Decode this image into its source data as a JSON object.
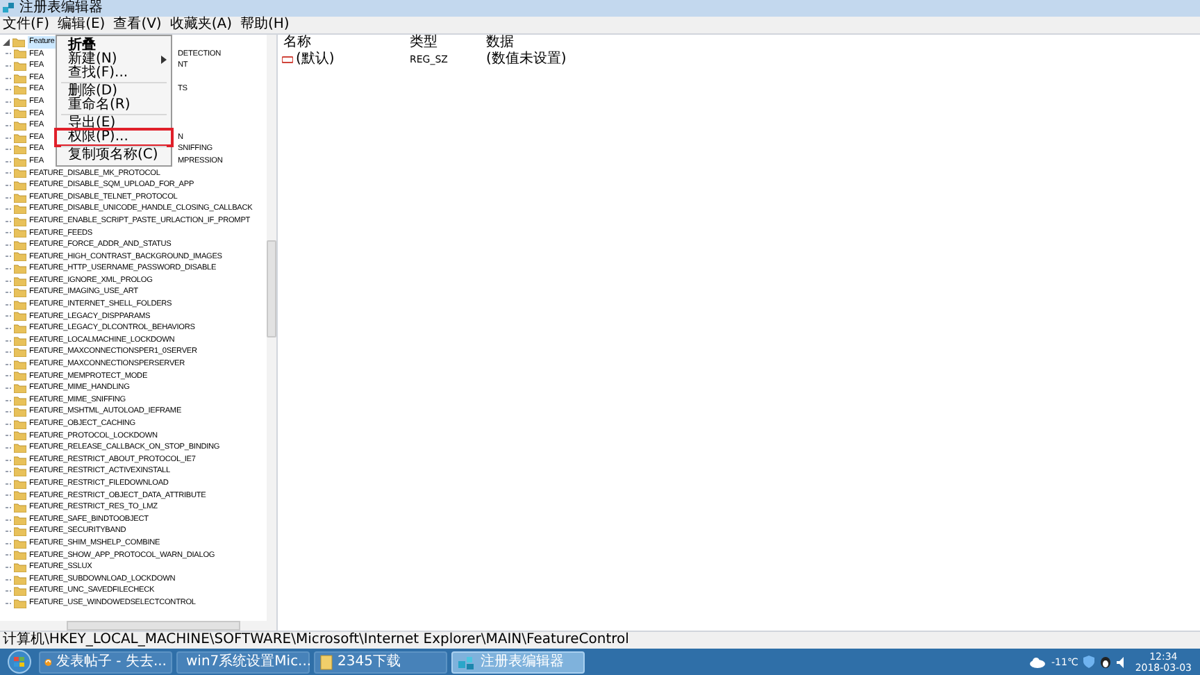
{
  "window": {
    "title": "注册表编辑器"
  },
  "menu_bar": [
    "文件(F)",
    "编辑(E)",
    "查看(V)",
    "收藏夹(A)",
    "帮助(H)"
  ],
  "tree": {
    "root": {
      "label": "Feature",
      "expanded": true,
      "selected": true
    },
    "covered_rows": [
      {
        "start": "FEA",
        "end": "DETECTION"
      },
      {
        "start": "FEA",
        "end": "NT"
      },
      {
        "start": "FEA",
        "end": ""
      },
      {
        "start": "FEA",
        "end": "TS"
      },
      {
        "start": "FEA",
        "end": ""
      },
      {
        "start": "FEA",
        "end": ""
      },
      {
        "start": "FEA",
        "end": ""
      },
      {
        "start": "FEA",
        "end": "N"
      },
      {
        "start": "FEA",
        "end": "SNIFFING"
      },
      {
        "start": "FEA",
        "end": "MPRESSION"
      }
    ],
    "rows": [
      "FEATURE_DISABLE_MK_PROTOCOL",
      "FEATURE_DISABLE_SQM_UPLOAD_FOR_APP",
      "FEATURE_DISABLE_TELNET_PROTOCOL",
      "FEATURE_DISABLE_UNICODE_HANDLE_CLOSING_CALLBACK",
      "FEATURE_ENABLE_SCRIPT_PASTE_URLACTION_IF_PROMPT",
      "FEATURE_FEEDS",
      "FEATURE_FORCE_ADDR_AND_STATUS",
      "FEATURE_HIGH_CONTRAST_BACKGROUND_IMAGES",
      "FEATURE_HTTP_USERNAME_PASSWORD_DISABLE",
      "FEATURE_IGNORE_XML_PROLOG",
      "FEATURE_IMAGING_USE_ART",
      "FEATURE_INTERNET_SHELL_FOLDERS",
      "FEATURE_LEGACY_DISPPARAMS",
      "FEATURE_LEGACY_DLCONTROL_BEHAVIORS",
      "FEATURE_LOCALMACHINE_LOCKDOWN",
      "FEATURE_MAXCONNECTIONSPER1_0SERVER",
      "FEATURE_MAXCONNECTIONSPERSERVER",
      "FEATURE_MEMPROTECT_MODE",
      "FEATURE_MIME_HANDLING",
      "FEATURE_MIME_SNIFFING",
      "FEATURE_MSHTML_AUTOLOAD_IEFRAME",
      "FEATURE_OBJECT_CACHING",
      "FEATURE_PROTOCOL_LOCKDOWN",
      "FEATURE_RELEASE_CALLBACK_ON_STOP_BINDING",
      "FEATURE_RESTRICT_ABOUT_PROTOCOL_IE7",
      "FEATURE_RESTRICT_ACTIVEXINSTALL",
      "FEATURE_RESTRICT_FILEDOWNLOAD",
      "FEATURE_RESTRICT_OBJECT_DATA_ATTRIBUTE",
      "FEATURE_RESTRICT_RES_TO_LMZ",
      "FEATURE_SAFE_BINDTOOBJECT",
      "FEATURE_SECURITYBAND",
      "FEATURE_SHIM_MSHELP_COMBINE",
      "FEATURE_SHOW_APP_PROTOCOL_WARN_DIALOG",
      "FEATURE_SSLUX",
      "FEATURE_SUBDOWNLOAD_LOCKDOWN",
      "FEATURE_UNC_SAVEDFILECHECK",
      "FEATURE_USE_WINDOWEDSELECTCONTROL"
    ]
  },
  "context_menu": [
    {
      "kind": "default",
      "label": "折叠",
      "highlighted": false
    },
    {
      "kind": "submenu",
      "label": "新建(N)",
      "highlighted": false
    },
    {
      "kind": "item",
      "label": "查找(F)...",
      "highlighted": false
    },
    {
      "kind": "separator"
    },
    {
      "kind": "item",
      "label": "删除(D)",
      "highlighted": false
    },
    {
      "kind": "item",
      "label": "重命名(R)",
      "highlighted": false
    },
    {
      "kind": "separator"
    },
    {
      "kind": "item",
      "label": "导出(E)",
      "highlighted": false
    },
    {
      "kind": "item",
      "label": "权限(P)...",
      "highlighted": true
    },
    {
      "kind": "separator"
    },
    {
      "kind": "item",
      "label": "复制项名称(C)",
      "highlighted": false
    }
  ],
  "values_table": {
    "columns": [
      "名称",
      "类型",
      "数据"
    ],
    "rows": [
      {
        "name": "(默认)",
        "type": "REG_SZ",
        "data": "(数值未设置)"
      }
    ]
  },
  "status_bar": "计算机\\HKEY_LOCAL_MACHINE\\SOFTWARE\\Microsoft\\Internet Explorer\\MAIN\\FeatureControl",
  "taskbar": {
    "buttons": [
      {
        "label": "发表帖子 - 失去...",
        "kind": "browser",
        "selected": false
      },
      {
        "label": "win7系统设置Mic...",
        "kind": "browser",
        "selected": false
      },
      {
        "label": "2345下载",
        "kind": "folder",
        "selected": false
      },
      {
        "label": "注册表编辑器",
        "kind": "regedit",
        "selected": true
      }
    ],
    "weather": "-11℃",
    "time": "12:34",
    "date": "2018-03-03"
  }
}
